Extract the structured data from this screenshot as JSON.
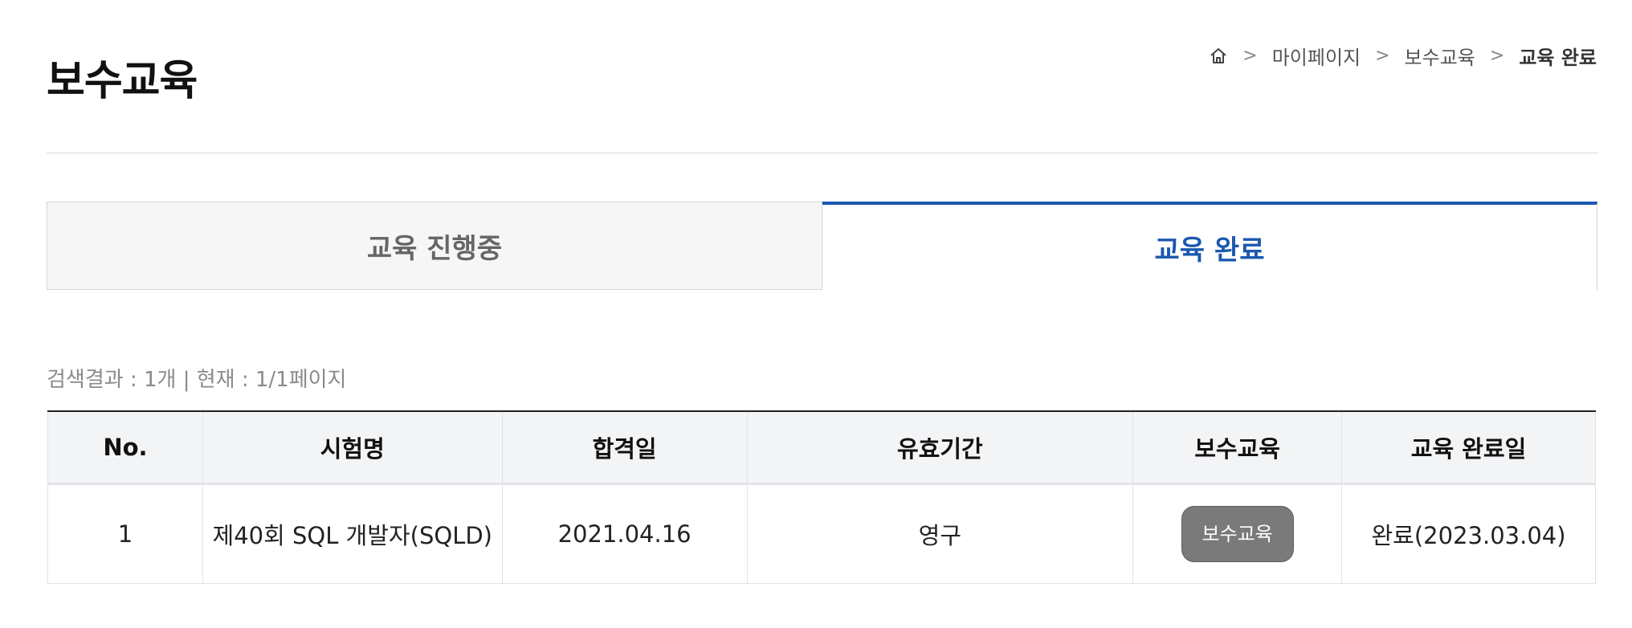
{
  "page": {
    "title": "보수교육"
  },
  "breadcrumb": {
    "icon": "home-icon",
    "items": [
      "마이페이지",
      "보수교육",
      "교육 완료"
    ]
  },
  "tabs": [
    {
      "label": "교육 진행중",
      "active": false
    },
    {
      "label": "교육 완료",
      "active": true
    }
  ],
  "summary": {
    "text": "검색결과 : 1개 | 현재 : 1/1페이지"
  },
  "table": {
    "headers": [
      "No.",
      "시험명",
      "합격일",
      "유효기간",
      "보수교육",
      "교육 완료일"
    ],
    "rows": [
      {
        "no": "1",
        "exam": "제40회 SQL 개발자(SQLD)",
        "pass_date": "2021.04.16",
        "validity": "영구",
        "action_label": "보수교육",
        "completed": "완료(2023.03.04)"
      }
    ]
  },
  "colors": {
    "accent": "#1b58b0",
    "badge": "#7a7a7a",
    "header_bg": "#f3f4f6"
  }
}
